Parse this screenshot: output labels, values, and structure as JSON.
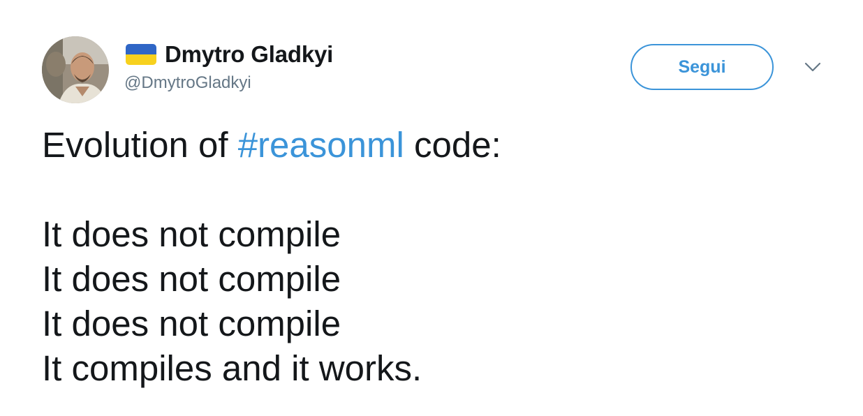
{
  "author": {
    "display_name": "Dmytro Gladkyi",
    "handle": "@DmytroGladkyi",
    "avatar_icon": "user-photo-icon",
    "flag_icon": "ukraine-flag-icon",
    "flag_colors": {
      "top": "#2f66c6",
      "bottom": "#f7d11e"
    }
  },
  "actions": {
    "follow_label": "Segui",
    "more_icon": "chevron-down-icon"
  },
  "tweet": {
    "prefix": "Evolution of ",
    "hashtag": "#reasonml",
    "suffix": " code:",
    "lines": [
      "It does not compile",
      "It does not compile",
      "It does not compile",
      "It compiles and it works."
    ]
  },
  "colors": {
    "accent": "#3b94d9",
    "text": "#14171a",
    "secondary": "#657786",
    "caret": "#657786"
  }
}
